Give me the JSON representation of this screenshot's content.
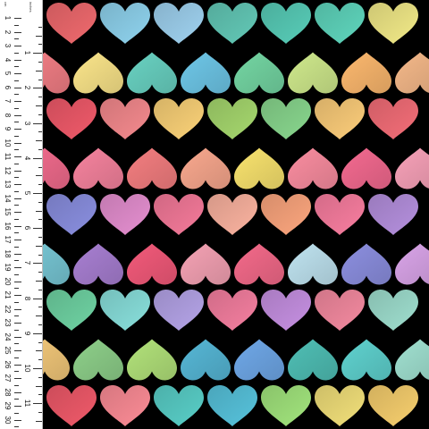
{
  "ruler": {
    "cm_unit": "cm",
    "inch_unit": "inches",
    "cm_labels": [
      "1",
      "2",
      "3",
      "4",
      "5",
      "6",
      "7",
      "8",
      "9",
      "10",
      "11",
      "12",
      "13",
      "14",
      "15",
      "16",
      "17",
      "18",
      "19",
      "20",
      "21",
      "22",
      "23",
      "24",
      "25",
      "26",
      "27",
      "28",
      "29",
      "30"
    ],
    "inch_labels": [
      "1",
      "2",
      "3",
      "4",
      "5",
      "6",
      "7",
      "8",
      "9",
      "10",
      "11",
      "12"
    ]
  },
  "pattern": {
    "rows": [
      {
        "dir": "up",
        "colors": [
          "#f06a6e",
          "#8fd3ee",
          "#9fd2f0",
          "#63c9b7",
          "#58cdb8",
          "#5fd6bd",
          "#f2ea88"
        ]
      },
      {
        "dir": "down",
        "colors": [
          "#f47f86",
          "#fbe58a",
          "#69d2c2",
          "#6ec7e8",
          "#74d6a3",
          "#cfe98c",
          "#fcb86e",
          "#f4b889"
        ]
      },
      {
        "dir": "up",
        "colors": [
          "#f05a6a",
          "#f58a8e",
          "#fbd278",
          "#a6d86e",
          "#89d78e",
          "#fccd7a",
          "#f46e78"
        ]
      },
      {
        "dir": "down",
        "colors": [
          "#f36c8e",
          "#f6839e",
          "#f47e80",
          "#f9a88e",
          "#f9e36e",
          "#fa8da0",
          "#f46a90",
          "#f7a1b8"
        ]
      },
      {
        "dir": "up",
        "colors": [
          "#8a8fe0",
          "#e58fd0",
          "#f57a9a",
          "#fbb3a0",
          "#fca67e",
          "#f97ea0",
          "#b590de"
        ]
      },
      {
        "dir": "down",
        "colors": [
          "#78c8d6",
          "#a87fd2",
          "#f35a7a",
          "#f5a2b4",
          "#f46a8a",
          "#bfe3f0",
          "#8c8fe0",
          "#d9a4e8"
        ]
      },
      {
        "dir": "up",
        "colors": [
          "#6fd3a3",
          "#89e0dc",
          "#b5a4e8",
          "#f57fa0",
          "#c690e2",
          "#f48aa0",
          "#9fdfcf"
        ]
      },
      {
        "dir": "down",
        "colors": [
          "#f4c97a",
          "#8ed08a",
          "#b2e27a",
          "#56b7d6",
          "#6fa8e8",
          "#4fbfb5",
          "#5fd2cf",
          "#a0e0d0"
        ]
      },
      {
        "dir": "up",
        "colors": [
          "#f05a6a",
          "#fc8c96",
          "#59cfc8",
          "#57c3dc",
          "#a2e57d",
          "#f2e07a",
          "#f7cf6e"
        ]
      }
    ]
  }
}
